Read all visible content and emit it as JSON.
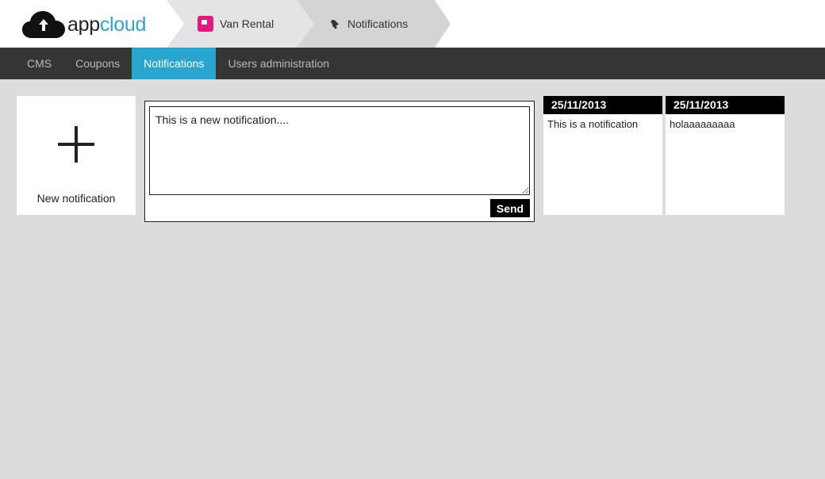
{
  "header": {
    "logo": {
      "app": "app",
      "cloud": "cloud",
      "icon": "cloud-upload-icon"
    },
    "breadcrumb": [
      {
        "label": "Van Rental",
        "icon": "app-icon",
        "color": "#e5177e"
      },
      {
        "label": "Notifications",
        "icon": "bell-icon"
      }
    ]
  },
  "nav": {
    "items": [
      {
        "label": "CMS"
      },
      {
        "label": "Coupons"
      },
      {
        "label": "Notifications",
        "active": true
      },
      {
        "label": "Users administration"
      }
    ],
    "active_color": "#2aa5cf"
  },
  "main": {
    "new_notification": {
      "label": "New notification",
      "icon": "plus-icon"
    },
    "composer": {
      "value": "This is a new notification....",
      "send_label": "Send"
    },
    "notifications": [
      {
        "date": "25/11/2013",
        "text": "This is a notification"
      },
      {
        "date": "25/11/2013",
        "text": "holaaaaaaaaa"
      }
    ]
  }
}
